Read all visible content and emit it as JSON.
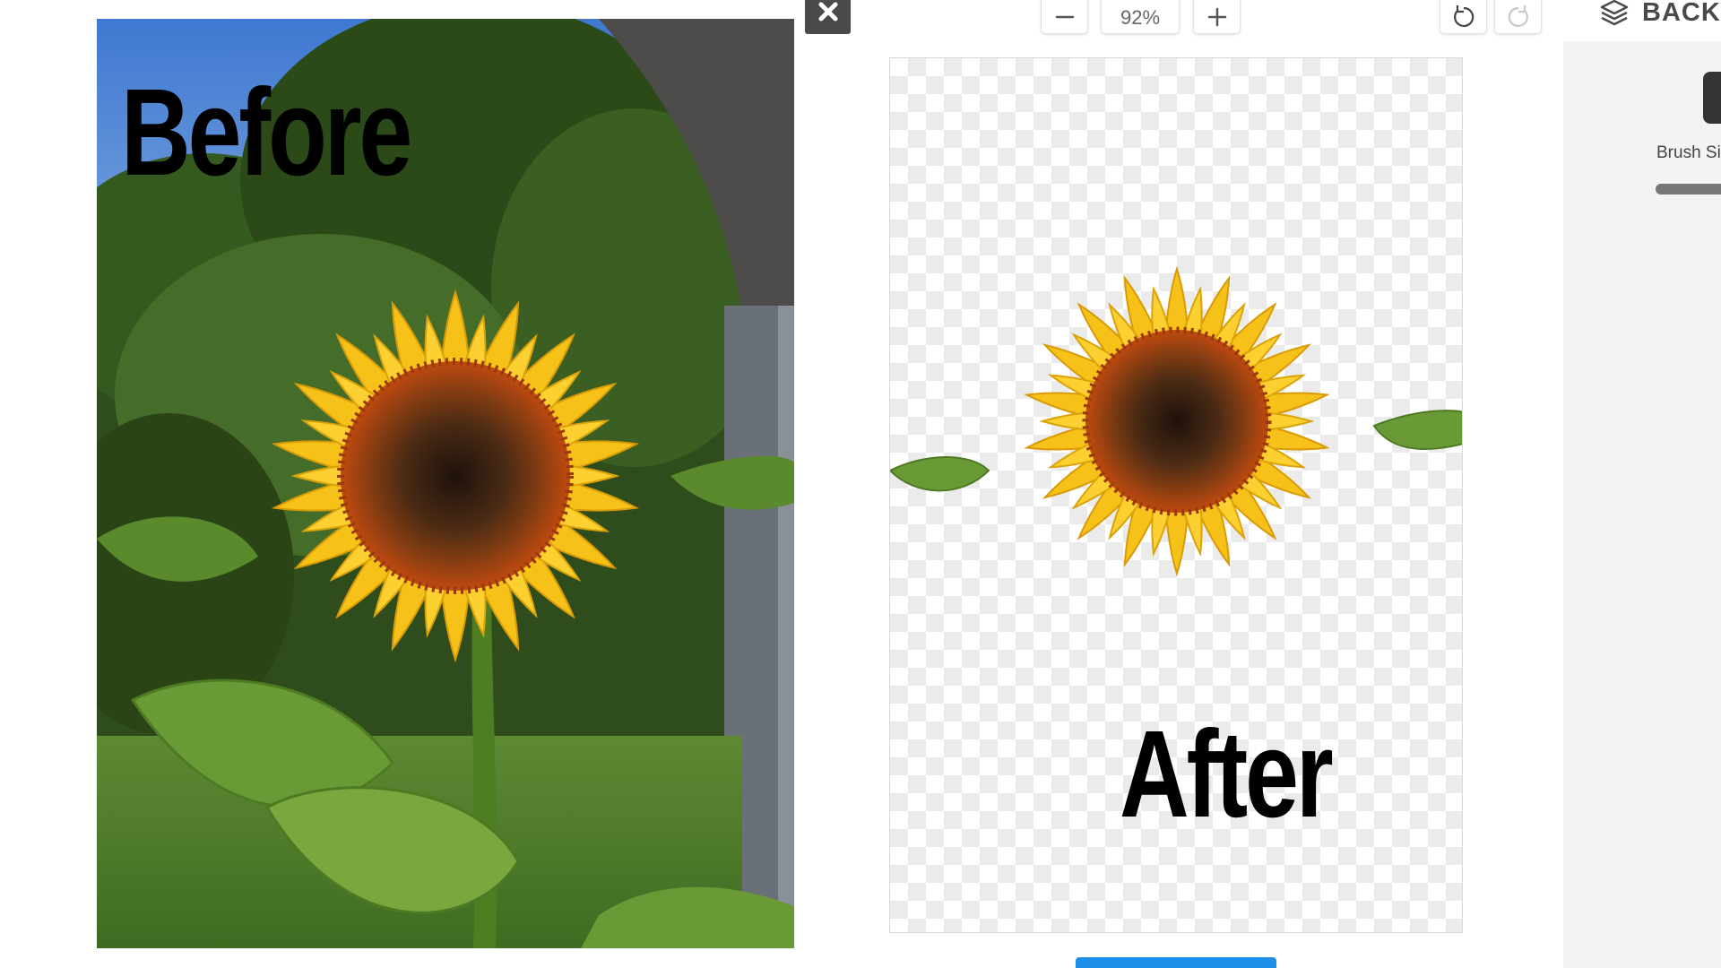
{
  "comparison": {
    "before_label": "Before",
    "after_label": "After"
  },
  "toolbar": {
    "zoom_level": "92%",
    "zoom_out_icon": "minus-icon",
    "zoom_in_icon": "plus-icon",
    "undo_icon": "undo-icon",
    "redo_icon": "redo-icon",
    "close_icon": "close-icon"
  },
  "sidebar": {
    "tab_label": "BACKG",
    "tab_icon": "layers-icon",
    "brush_size_label": "Brush Si"
  },
  "colors": {
    "accent_blue": "#1e8fe8",
    "petal_yellow": "#f6c21a",
    "disc_orange": "#b5430f",
    "disc_center": "#3a2214",
    "leaf_green": "#5c8f2e",
    "sky_blue": "#4a7fc9"
  }
}
